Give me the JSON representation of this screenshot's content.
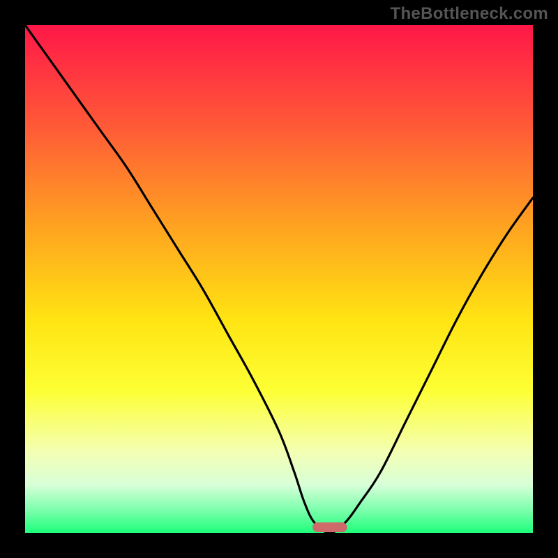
{
  "watermark": {
    "text": "TheBottleneck.com"
  },
  "colors": {
    "frame_bg": "#000000",
    "curve": "#000000",
    "marker_fill": "#cf6a6a",
    "gradient_stops": [
      {
        "offset": 0.0,
        "color": "#ff1748"
      },
      {
        "offset": 0.2,
        "color": "#ff5a37"
      },
      {
        "offset": 0.4,
        "color": "#ffa420"
      },
      {
        "offset": 0.58,
        "color": "#ffe412"
      },
      {
        "offset": 0.72,
        "color": "#fdff34"
      },
      {
        "offset": 0.84,
        "color": "#f4ffb3"
      },
      {
        "offset": 0.905,
        "color": "#d8ffd8"
      },
      {
        "offset": 0.955,
        "color": "#7cffad"
      },
      {
        "offset": 1.0,
        "color": "#1dff7a"
      }
    ]
  },
  "chart_data": {
    "type": "line",
    "title": "",
    "xlabel": "",
    "ylabel": "",
    "xlim": [
      0,
      100
    ],
    "ylim": [
      0,
      100
    ],
    "x": [
      0,
      5,
      10,
      15,
      20,
      25,
      30,
      35,
      40,
      45,
      50,
      53,
      55,
      57,
      60,
      63,
      66,
      70,
      75,
      80,
      85,
      90,
      95,
      100
    ],
    "values": [
      100,
      93,
      86,
      79,
      72,
      64,
      56,
      48,
      39,
      30,
      20,
      12,
      6,
      2,
      0,
      2,
      6,
      12,
      22,
      32,
      42,
      51,
      59,
      66
    ],
    "optimum_x": 60,
    "marker": {
      "x_center": 60,
      "x_halfwidth": 3.4,
      "y": 0
    }
  }
}
